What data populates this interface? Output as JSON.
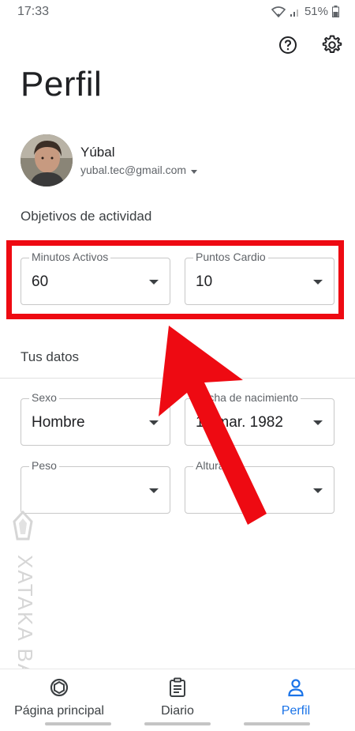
{
  "status_bar": {
    "time": "17:33",
    "battery": "51%"
  },
  "header": {
    "title": "Perfil",
    "help_icon": "help-circle-icon",
    "settings_icon": "gear-icon"
  },
  "profile": {
    "name": "Yúbal",
    "email": "yubal.tec@gmail.com"
  },
  "activity_goals": {
    "title": "Objetivos de actividad",
    "fields": [
      {
        "label": "Minutos Activos",
        "value": "60"
      },
      {
        "label": "Puntos Cardio",
        "value": "10"
      }
    ]
  },
  "your_data": {
    "title": "Tus datos",
    "fields": [
      {
        "label": "Sexo",
        "value": "Hombre"
      },
      {
        "label": "Fecha de nacimiento",
        "value": "18 mar. 1982"
      },
      {
        "label": "Peso",
        "value": ""
      },
      {
        "label": "Altura",
        "value": ""
      }
    ]
  },
  "annotation": {
    "highlight_color": "#ee0a12"
  },
  "watermark": {
    "text": "XATAKA BASICS"
  },
  "bottom_nav": {
    "items": [
      {
        "label": "Página principal",
        "icon": "home-ring-icon"
      },
      {
        "label": "Diario",
        "icon": "journal-icon"
      },
      {
        "label": "Perfil",
        "icon": "person-icon"
      }
    ],
    "active": "Perfil",
    "active_color": "#1a73e8"
  }
}
